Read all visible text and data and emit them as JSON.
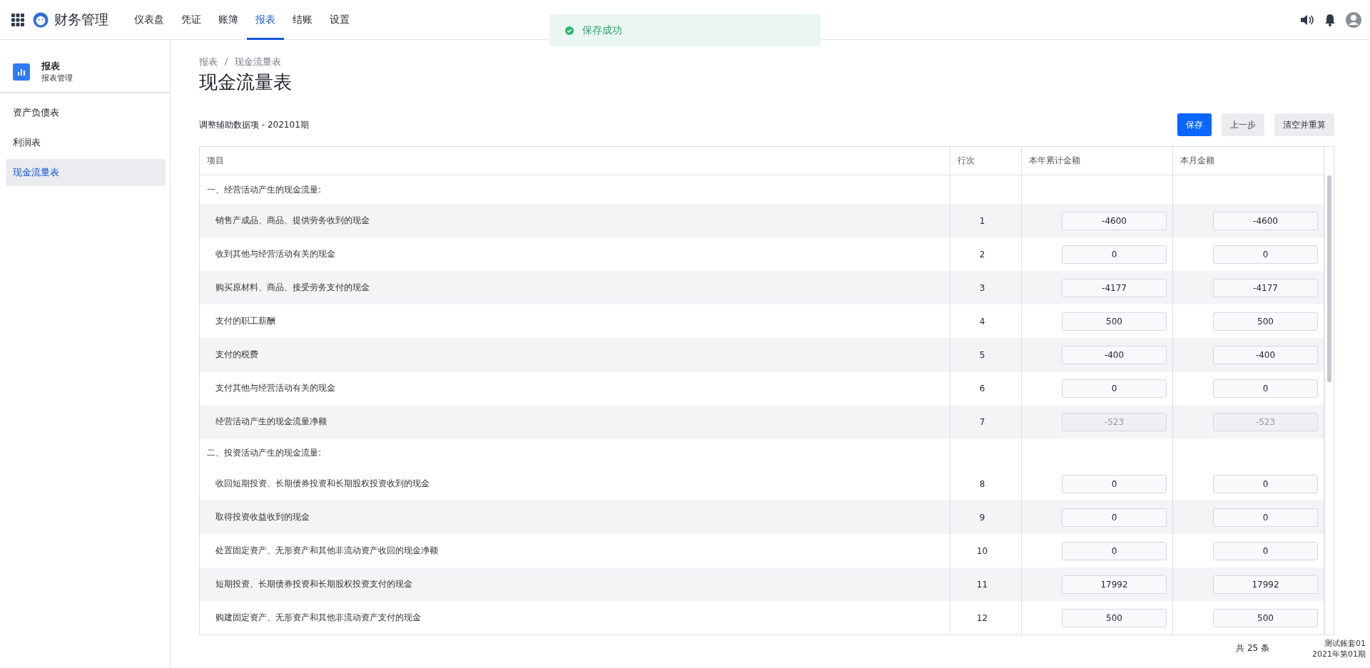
{
  "app": {
    "title": "财务管理"
  },
  "nav": [
    {
      "label": "仪表盘",
      "selected": false
    },
    {
      "label": "凭证",
      "selected": false
    },
    {
      "label": "账簿",
      "selected": false
    },
    {
      "label": "报表",
      "selected": true
    },
    {
      "label": "结账",
      "selected": false
    },
    {
      "label": "设置",
      "selected": false
    }
  ],
  "toast": {
    "text": "保存成功"
  },
  "sidebar": {
    "title": "报表",
    "subtitle": "报表管理",
    "items": [
      {
        "label": "资产负债表",
        "selected": false
      },
      {
        "label": "利润表",
        "selected": false
      },
      {
        "label": "现金流量表",
        "selected": true
      }
    ]
  },
  "breadcrumb": {
    "items": [
      "报表",
      "现金流量表"
    ],
    "separator": "/"
  },
  "page_title": "现金流量表",
  "subtitle": "调整辅助数据项 - 202101期",
  "buttons": [
    {
      "label": "保存",
      "kind": "primary"
    },
    {
      "label": "上一步",
      "kind": "secondary"
    },
    {
      "label": "清空并重算",
      "kind": "secondary"
    }
  ],
  "table": {
    "columns": [
      "项目",
      "行次",
      "本年累计金额",
      "本月金额"
    ],
    "rows": [
      {
        "kind": "section",
        "label": "一、经营活动产生的现金流量:"
      },
      {
        "kind": "item",
        "label": "销售产成品、商品、提供劳务收到的现金",
        "line": "1",
        "year": "-4600",
        "month": "-4600",
        "disabled": false
      },
      {
        "kind": "item",
        "label": "收到其他与经营活动有关的现金",
        "line": "2",
        "year": "0",
        "month": "0",
        "disabled": false
      },
      {
        "kind": "item",
        "label": "购买原材料、商品、接受劳务支付的现金",
        "line": "3",
        "year": "-4177",
        "month": "-4177",
        "disabled": false
      },
      {
        "kind": "item",
        "label": "支付的职工薪酬",
        "line": "4",
        "year": "500",
        "month": "500",
        "disabled": false
      },
      {
        "kind": "item",
        "label": "支付的税费",
        "line": "5",
        "year": "-400",
        "month": "-400",
        "disabled": false
      },
      {
        "kind": "item",
        "label": "支付其他与经营活动有关的现金",
        "line": "6",
        "year": "0",
        "month": "0",
        "disabled": false
      },
      {
        "kind": "item",
        "label": "经营活动产生的现金流量净额",
        "line": "7",
        "year": "-523",
        "month": "-523",
        "disabled": true
      },
      {
        "kind": "section",
        "label": "二、投资活动产生的现金流量:"
      },
      {
        "kind": "item",
        "label": "收回短期投资、长期债券投资和长期股权投资收到的现金",
        "line": "8",
        "year": "0",
        "month": "0",
        "disabled": false
      },
      {
        "kind": "item",
        "label": "取得投资收益收到的现金",
        "line": "9",
        "year": "0",
        "month": "0",
        "disabled": false
      },
      {
        "kind": "item",
        "label": "处置固定资产、无形资产和其他非流动资产收回的现金净额",
        "line": "10",
        "year": "0",
        "month": "0",
        "disabled": false
      },
      {
        "kind": "item",
        "label": "短期投资、长期债券投资和长期股权投资支付的现金",
        "line": "11",
        "year": "17992",
        "month": "17992",
        "disabled": false
      },
      {
        "kind": "item",
        "label": "购建固定资产、无形资产和其他非流动资产支付的现金",
        "line": "12",
        "year": "500",
        "month": "500",
        "disabled": false
      }
    ]
  },
  "account": {
    "name": "测试账套01",
    "period": "2021年第01期"
  },
  "total": "共 25 条"
}
